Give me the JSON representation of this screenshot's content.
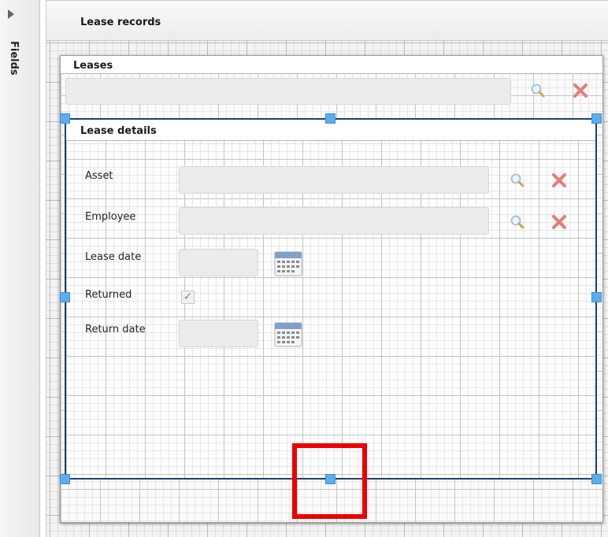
{
  "fields_panel": {
    "label": "Fields",
    "expand_icon": "triangle-right-icon"
  },
  "title_bar": {
    "title": "Lease records"
  },
  "leases_panel": {
    "header": "Leases",
    "lookup_icon": "magnifier-icon",
    "clear_icon": "red-x-icon"
  },
  "details_panel": {
    "header": "Lease details",
    "fields": {
      "asset": {
        "label": "Asset"
      },
      "employee": {
        "label": "Employee"
      },
      "lease_date": {
        "label": "Lease date"
      },
      "returned": {
        "label": "Returned",
        "checked": true,
        "check_glyph": "✓"
      },
      "return_date": {
        "label": "Return date"
      }
    }
  },
  "colors": {
    "selection_border": "#1f3f6e",
    "handle": "#5aaef0",
    "highlight": "#ee0000",
    "clear_icon": "#e66a6a"
  }
}
